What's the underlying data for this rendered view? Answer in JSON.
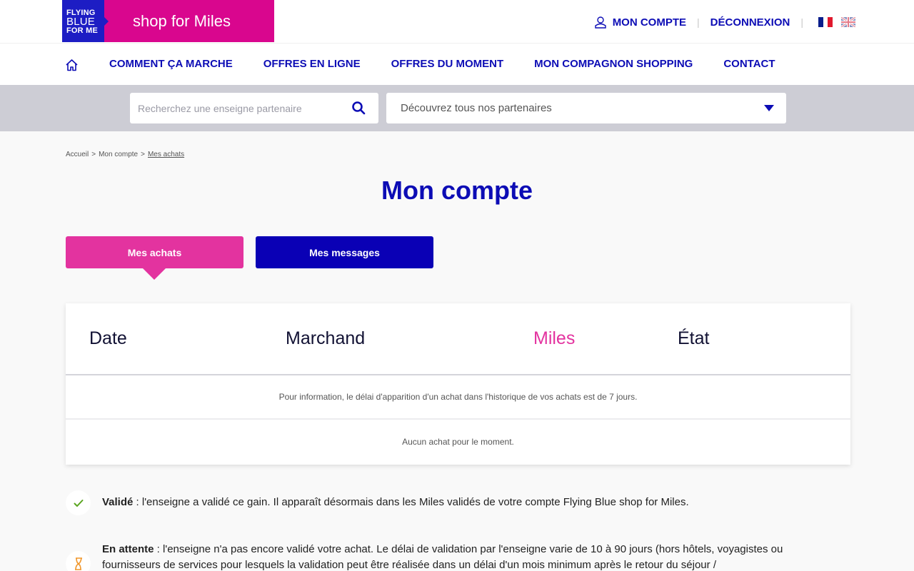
{
  "brand": {
    "logo_line1": "FLYING",
    "logo_line2": "BLUE",
    "logo_line3": "FOR ME",
    "tagline": "shop for Miles",
    "primary_color": "#0c0cb5",
    "accent_color": "#d9068e"
  },
  "account_nav": {
    "account_label": "MON COMPTE",
    "logout_label": "DÉCONNEXION",
    "separator": "|",
    "languages": [
      "fr",
      "en"
    ]
  },
  "main_nav": {
    "home_icon": "home-icon",
    "items": [
      {
        "label": "COMMENT ÇA MARCHE"
      },
      {
        "label": "OFFRES EN LIGNE"
      },
      {
        "label": "OFFRES DU MOMENT"
      },
      {
        "label": "MON COMPAGNON SHOPPING"
      },
      {
        "label": "CONTACT"
      }
    ]
  },
  "search": {
    "placeholder": "Recherchez une enseigne partenaire",
    "value": "",
    "partner_select_value": "Découvrez tous nos partenaires"
  },
  "breadcrumb": {
    "items": [
      "Accueil",
      "Mon compte",
      "Mes achats"
    ],
    "separator": ">"
  },
  "page": {
    "title": "Mon compte"
  },
  "tabs": [
    {
      "label": "Mes achats",
      "active": true
    },
    {
      "label": "Mes messages",
      "active": false
    }
  ],
  "purchases_table": {
    "columns": [
      "Date",
      "Marchand",
      "Miles",
      "État"
    ],
    "info_message": "Pour information, le délai d'apparition d'un achat dans l'historique de vos achats est de 7 jours.",
    "empty_message": "Aucun achat pour le moment."
  },
  "legend": [
    {
      "icon": "check-icon",
      "term": "Validé",
      "description": " : l'enseigne a validé ce gain. Il apparaît désormais dans les Miles validés de votre compte Flying Blue shop for Miles."
    },
    {
      "icon": "hourglass-icon",
      "term": "En attente",
      "description": " : l'enseigne n'a pas encore validé votre achat. Le délai de validation par l'enseigne varie de 10 à 90 jours (hors hôtels, voyagistes ou fournisseurs de services pour lesquels la validation peut être réalisée dans un délai d'un mois minimum après le retour du séjour /"
    }
  ]
}
